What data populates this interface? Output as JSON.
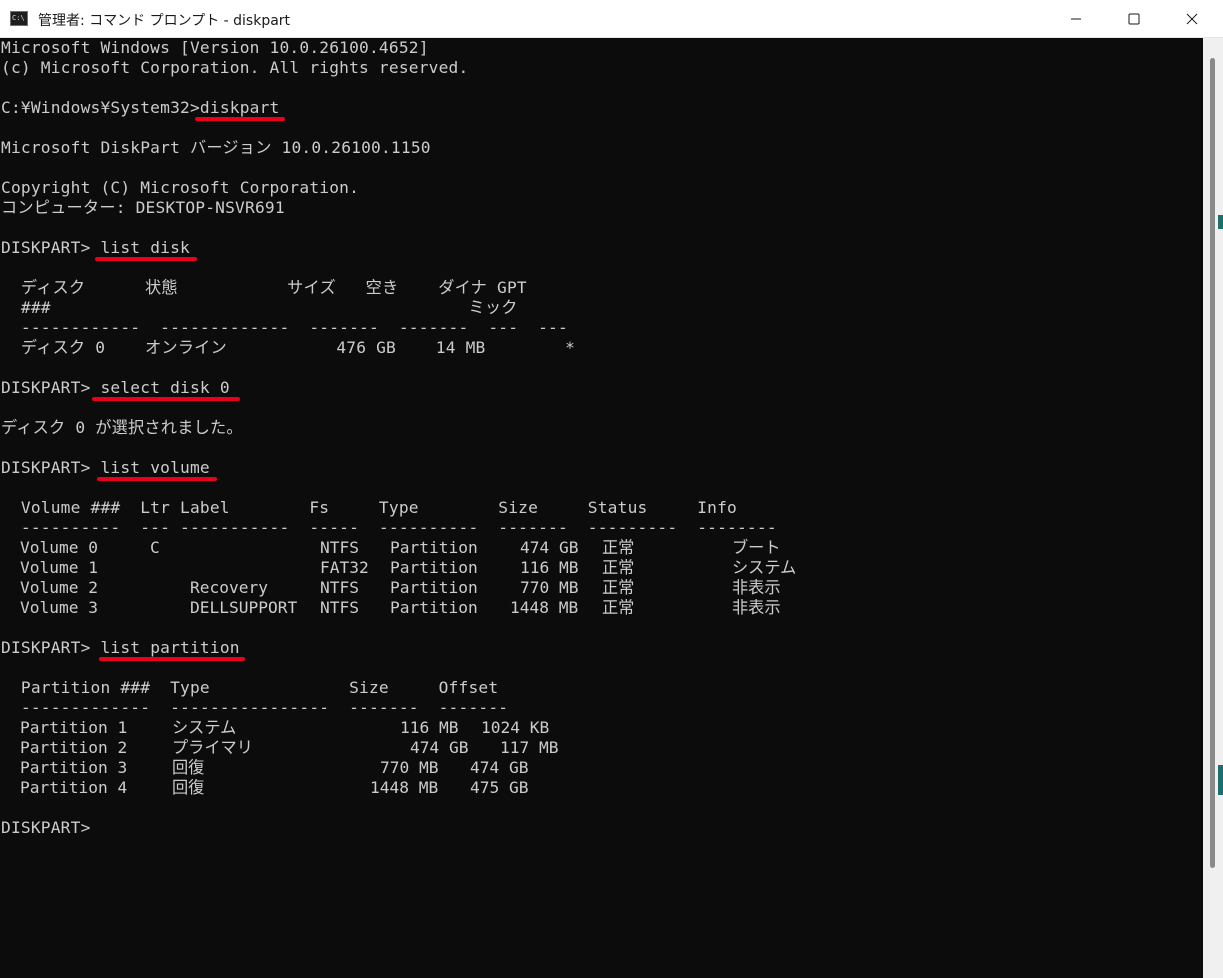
{
  "window": {
    "title": "管理者: コマンド プロンプト - diskpart",
    "icon": "cmd-icon",
    "icon_text": "C:\\",
    "controls": [
      "minimize-icon",
      "maximize-icon",
      "close-icon"
    ]
  },
  "console": {
    "header": [
      "Microsoft Windows [Version 10.0.26100.4652]",
      "(c) Microsoft Corporation. All rights reserved."
    ],
    "prompt_cmd": "C:¥Windows¥System32>",
    "cmd_diskpart": "diskpart",
    "diskpart_version": "Microsoft DiskPart バージョン 10.0.26100.1150",
    "copyright": "Copyright (C) Microsoft Corporation.",
    "computer": "コンピューター: DESKTOP-NSVR691",
    "prompt_dp": "DISKPART> ",
    "cmd_list_disk": "list disk",
    "disk_table": {
      "header1": "  ディスク      状態           サイズ   空き    ダイナ GPT",
      "header2": "  ###                                          ミック",
      "separator": "  ------------  -------------  -------  -------  ---  ---",
      "row1": "  ディスク 0    オンライン           476 GB    14 MB        *"
    },
    "cmd_select_disk": "select disk 0",
    "select_result": "ディスク 0 が選択されました。",
    "cmd_list_volume": "list volume",
    "volume_table": {
      "header": "  Volume ###  Ltr Label        Fs     Type        Size     Status     Info",
      "separator": "  ----------  --- -----------  -----  ----------  -------  ---------  --------",
      "rows": [
        {
          "vol": "Volume 0",
          "ltr": "C",
          "label": "",
          "fs": "NTFS",
          "type": "Partition",
          "size": "474 GB",
          "status": "正常",
          "info": "ブート"
        },
        {
          "vol": "Volume 1",
          "ltr": "",
          "label": "",
          "fs": "FAT32",
          "type": "Partition",
          "size": "116 MB",
          "status": "正常",
          "info": "システム"
        },
        {
          "vol": "Volume 2",
          "ltr": "",
          "label": "Recovery",
          "fs": "NTFS",
          "type": "Partition",
          "size": "770 MB",
          "status": "正常",
          "info": "非表示"
        },
        {
          "vol": "Volume 3",
          "ltr": "",
          "label": "DELLSUPPORT",
          "fs": "NTFS",
          "type": "Partition",
          "size": "1448 MB",
          "status": "正常",
          "info": "非表示"
        }
      ]
    },
    "cmd_list_partition": "list partition",
    "partition_table": {
      "header": "  Partition ###  Type              Size     Offset",
      "separator": "  -------------  ----------------  -------  -------",
      "rows": [
        {
          "part": "Partition 1",
          "type": "システム",
          "size": "116 MB",
          "offset": "1024 KB"
        },
        {
          "part": "Partition 2",
          "type": "プライマリ",
          "size": "474 GB",
          "offset": "117 MB"
        },
        {
          "part": "Partition 3",
          "type": "回復",
          "size": "770 MB",
          "offset": "474 GB"
        },
        {
          "part": "Partition 4",
          "type": "回復",
          "size": "1448 MB",
          "offset": "475 GB"
        }
      ]
    },
    "final_prompt": "DISKPART>"
  },
  "colors": {
    "console_bg": "#0c0c0c",
    "console_fg": "#cccccc",
    "annotation_underline": "#e8001c",
    "titlebar_bg": "#ffffff"
  }
}
